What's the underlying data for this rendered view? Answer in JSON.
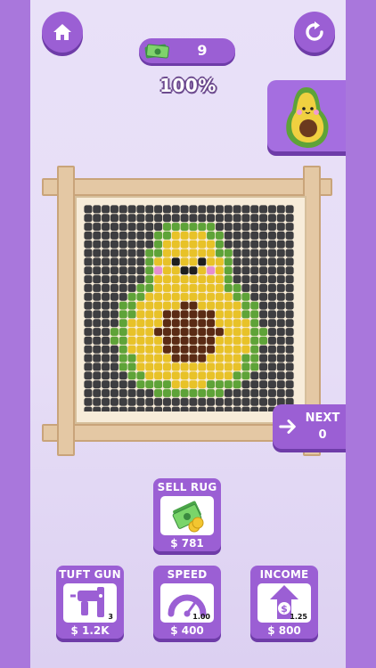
{
  "header": {
    "cash": "9",
    "progress_percent": "100%",
    "progress_fraction": 1.0
  },
  "next_button": {
    "label": "NEXT",
    "value": "0"
  },
  "upgrades": {
    "sell_rug": {
      "title": "SELL RUG",
      "price": "$ 781"
    },
    "tuft_gun": {
      "title": "TUFT GUN",
      "price": "$ 1.2K",
      "level": "3"
    },
    "speed": {
      "title": "SPEED",
      "price": "$ 400",
      "level": "1.00"
    },
    "income": {
      "title": "INCOME",
      "price": "$ 800",
      "level": "1.25"
    }
  },
  "colors": {
    "purple_accent": "#9b5fd4",
    "rug_background": "#3d3d40",
    "avocado_skin": "#5ea338",
    "avocado_flesh": "#e8c228",
    "avocado_pit": "#5a2a14",
    "cheek": "#e58fd0"
  },
  "icons": [
    "home-icon",
    "refresh-icon",
    "cash-icon",
    "arrow-right-icon",
    "money-stack-icon",
    "tuft-gun-icon",
    "speedometer-icon",
    "income-arrow-icon"
  ]
}
